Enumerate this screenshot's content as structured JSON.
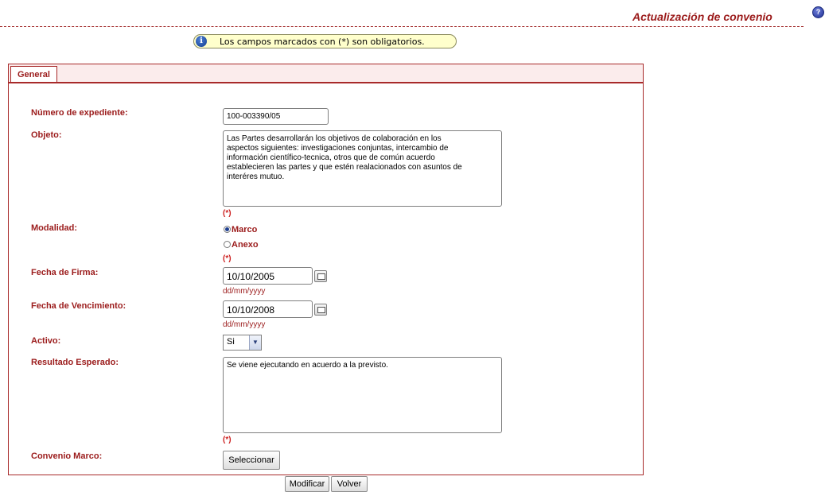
{
  "header": {
    "title": "Actualización de convenio",
    "help_icon": "help-icon"
  },
  "notice": {
    "text": "Los campos marcados con (*) son obligatorios.",
    "icon": "info-icon"
  },
  "tabs": [
    {
      "label": "General",
      "active": true
    }
  ],
  "form": {
    "expediente": {
      "label": "Número de expediente:",
      "value": "100-003390/05"
    },
    "objeto": {
      "label": "Objeto:",
      "value": "Las Partes desarrollarán los objetivos de colaboración en los\naspectos siguientes: investigaciones conjuntas, intercambio de\ninformación científico-tecnica, otros que de común acuerdo\nestablecieren las partes y que estén realacionados con asuntos de\ninteréres mutuo.",
      "required": "(*)"
    },
    "modalidad": {
      "label": "Modalidad:",
      "options": [
        {
          "label": "Marco",
          "checked": true
        },
        {
          "label": "Anexo",
          "checked": false
        }
      ],
      "required": "(*)"
    },
    "fecha_firma": {
      "label": "Fecha de Firma:",
      "value": "10/10/2005",
      "format_hint": "dd/mm/yyyy"
    },
    "fecha_vencimiento": {
      "label": "Fecha de Vencimiento:",
      "value": "10/10/2008",
      "format_hint": "dd/mm/yyyy"
    },
    "activo": {
      "label": "Activo:",
      "selected": "Si"
    },
    "resultado": {
      "label": "Resultado Esperado:",
      "value": "Se viene ejecutando en acuerdo a la previsto.",
      "required": "(*)"
    },
    "convenio_marco": {
      "label": "Convenio Marco:",
      "button_label": "Seleccionar"
    }
  },
  "actions": {
    "modify_label": "Modificar",
    "back_label": "Volver"
  },
  "colors": {
    "accent": "#9b1b1b",
    "required": "#cc1f1f",
    "notice_bg": "#ffffcc",
    "tab_bg": "#fbecec"
  }
}
